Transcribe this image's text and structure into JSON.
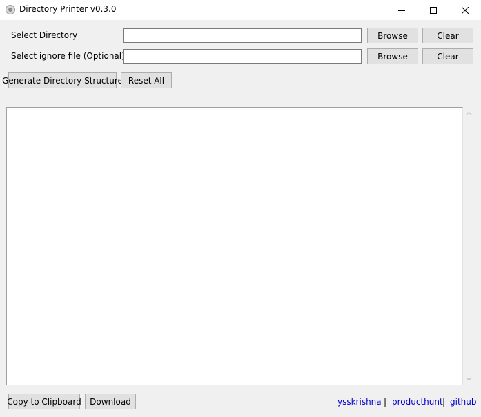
{
  "window": {
    "title": "Directory Printer v0.3.0",
    "icons": {
      "app": "app-icon",
      "minimize": "minimize-icon",
      "maximize": "maximize-icon",
      "close": "close-icon"
    }
  },
  "form": {
    "directory": {
      "label": "Select Directory",
      "value": "",
      "browse_label": "Browse",
      "clear_label": "Clear"
    },
    "ignore_file": {
      "label": "Select ignore file (Optional)",
      "value": "",
      "browse_label": "Browse",
      "clear_label": "Clear"
    }
  },
  "actions": {
    "generate_label": "Generate Directory Structure",
    "reset_label": "Reset All"
  },
  "output": {
    "text": ""
  },
  "footer": {
    "copy_label": "Copy to Clipboard",
    "download_label": "Download",
    "links": [
      "ysskrishna",
      "producthunt",
      "github"
    ],
    "separator": "|"
  },
  "colors": {
    "window_bg": "#f0f0f0",
    "button_bg": "#e1e1e1",
    "button_border": "#adadad",
    "link": "#0000cc"
  }
}
